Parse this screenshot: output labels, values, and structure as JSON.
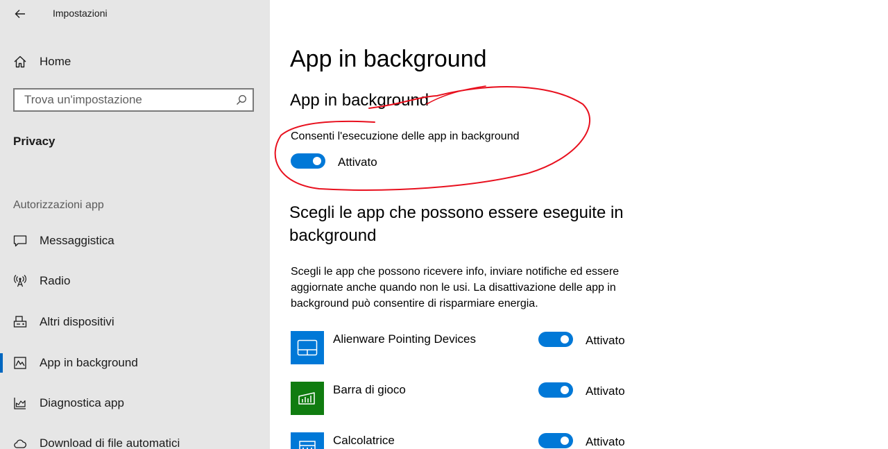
{
  "window": {
    "title": "Impostazioni"
  },
  "sidebar": {
    "home_label": "Home",
    "search_placeholder": "Trova un'impostazione",
    "section_title": "Privacy",
    "group_label": "Autorizzazioni app",
    "items": [
      {
        "label": "Messaggistica",
        "icon": "message-icon"
      },
      {
        "label": "Radio",
        "icon": "radio-antenna-icon"
      },
      {
        "label": "Altri dispositivi",
        "icon": "devices-icon"
      },
      {
        "label": "App in background",
        "icon": "background-apps-icon",
        "active": true
      },
      {
        "label": "Diagnostica app",
        "icon": "diagnostics-icon"
      },
      {
        "label": "Download di file automatici",
        "icon": "cloud-icon"
      }
    ]
  },
  "main": {
    "page_title": "App in background",
    "section_title": "App in background",
    "allow_label": "Consenti l'esecuzione delle app in background",
    "allow_state": "Attivato",
    "choose_heading": "Scegli le app che possono essere eseguite in background",
    "description": "Scegli le app che possono ricevere info, inviare notifiche ed essere aggiornate anche quando non le usi. La disattivazione delle app in background può consentire di risparmiare energia.",
    "apps": [
      {
        "name": "Alienware Pointing Devices",
        "state": "Attivato",
        "tile_color": "#0078d7",
        "icon": "touchpad-icon"
      },
      {
        "name": "Barra di gioco",
        "state": "Attivato",
        "tile_color": "#107c10",
        "icon": "game-bar-icon"
      },
      {
        "name": "Calcolatrice",
        "state": "Attivato",
        "tile_color": "#0078d7",
        "icon": "calculator-icon"
      }
    ]
  },
  "colors": {
    "accent": "#0078d7",
    "sidebar_bg": "#e6e6e6",
    "annotation": "#e8101e"
  }
}
